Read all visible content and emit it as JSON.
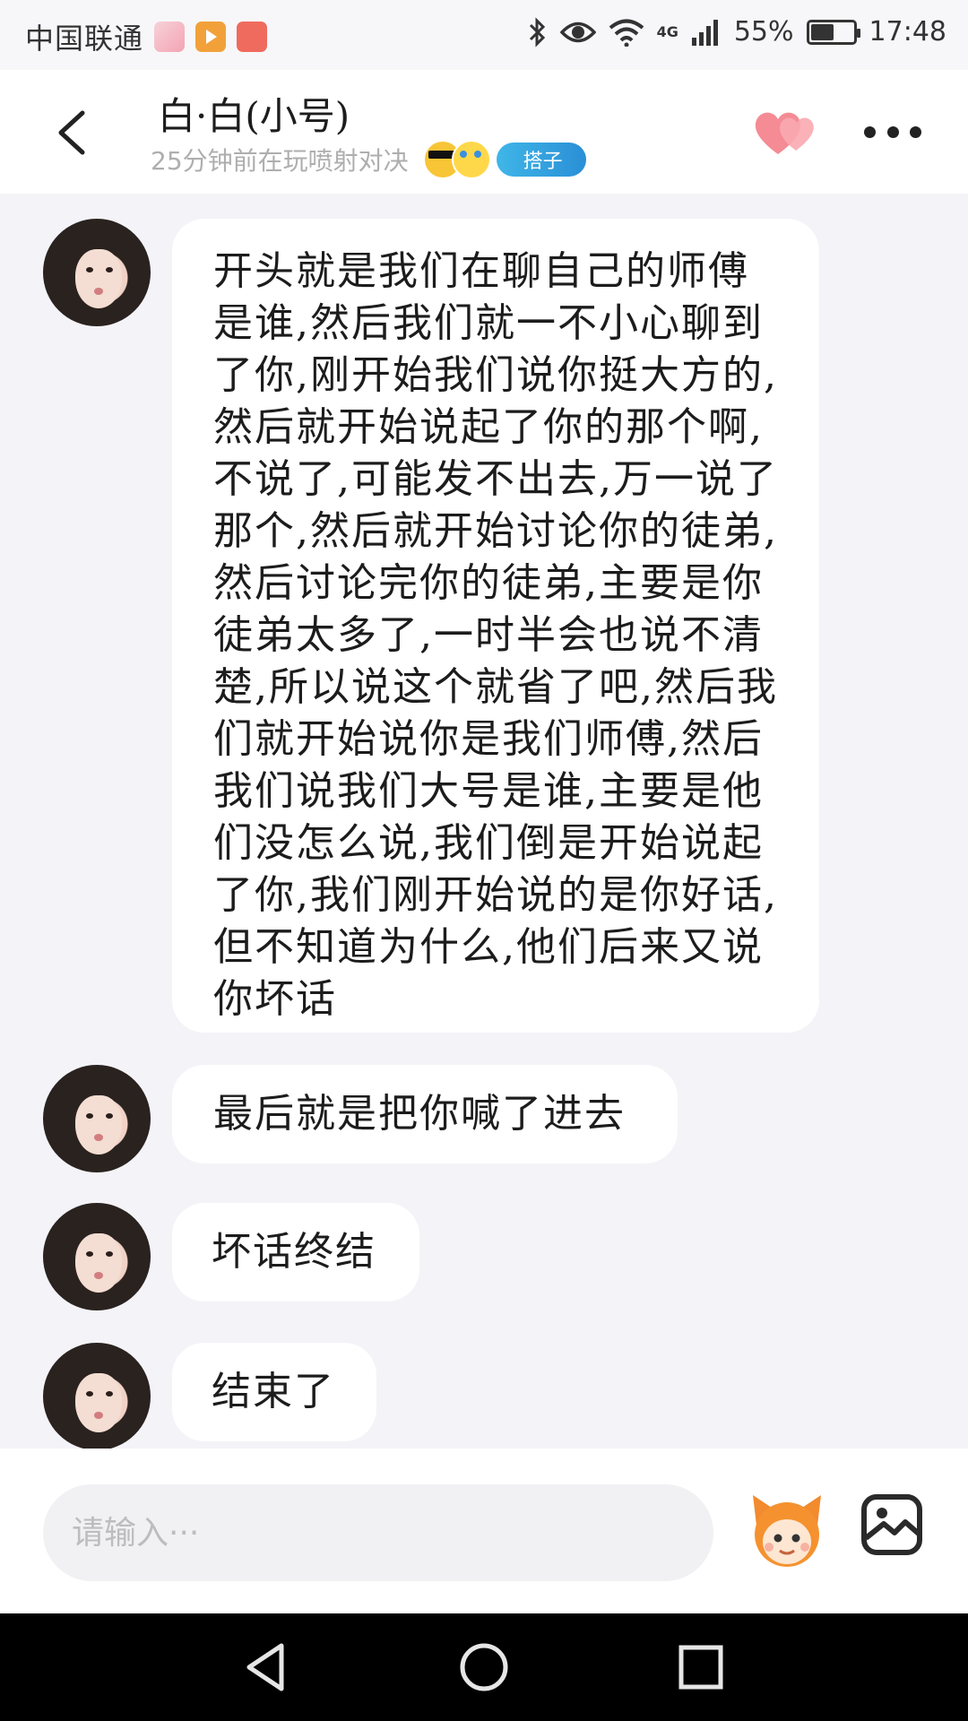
{
  "status_bar": {
    "carrier": "中国联通",
    "network": "4G",
    "battery": "55%",
    "battery_level": 0.55,
    "time": "17:48"
  },
  "header": {
    "title": "白·白(小号)",
    "subtitle": "25分钟前在玩喷射对决",
    "badge": "搭子",
    "icons": [
      "back-icon",
      "heart-icon",
      "more-icon"
    ]
  },
  "messages": [
    {
      "sender": "白·白(小号)",
      "text": "开头就是我们在聊自己的师傅是谁,然后我们就一不小心聊到了你,刚开始我们说你挺大方的,然后就开始说起了你的那个啊,不说了,可能发不出去,万一说了那个,然后就开始讨论你的徒弟,然后讨论完你的徒弟,主要是你徒弟太多了,一时半会也说不清楚,所以说这个就省了吧,然后我们就开始说你是我们师傅,然后我们说我们大号是谁,主要是他们没怎么说,我们倒是开始说起了你,我们刚开始说的是你好话,但不知道为什么,他们后来又说你坏话"
    },
    {
      "sender": "白·白(小号)",
      "text": "最后就是把你喊了进去"
    },
    {
      "sender": "白·白(小号)",
      "text": "坏话终结"
    },
    {
      "sender": "白·白(小号)",
      "text": "结束了"
    }
  ],
  "input": {
    "placeholder": "请输入···",
    "value": ""
  },
  "colors": {
    "chat_background": "#f3f3f8",
    "bubble": "#ffffff",
    "heart": "#f27a86",
    "badge": "#2a9be0"
  }
}
